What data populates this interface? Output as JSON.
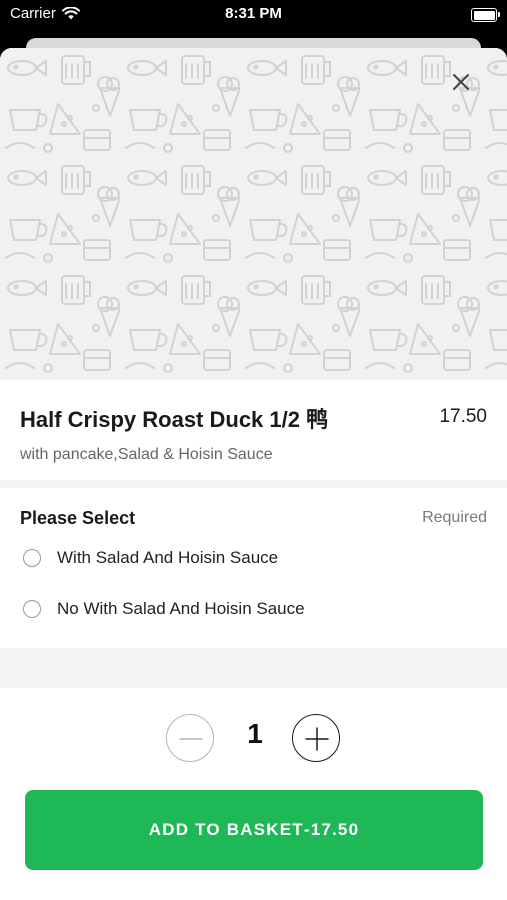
{
  "status_bar": {
    "carrier": "Carrier",
    "time": "8:31 PM"
  },
  "item": {
    "title": "Half Crispy Roast Duck 1/2 鸭",
    "price": "17.50",
    "description": "with pancake,Salad & Hoisin Sauce"
  },
  "option_group": {
    "title": "Please Select",
    "requirement": "Required",
    "options": [
      {
        "label": "With Salad And Hoisin Sauce",
        "selected": false
      },
      {
        "label": "No With Salad And Hoisin Sauce",
        "selected": false
      }
    ]
  },
  "quantity": {
    "value": "1"
  },
  "cta": {
    "label": "ADD TO BASKET",
    "separator": "-",
    "price": "17.50"
  },
  "colors": {
    "accent": "#1fb857",
    "hero_bg": "#f1f1f1",
    "doodle": "#d0d0d0"
  }
}
